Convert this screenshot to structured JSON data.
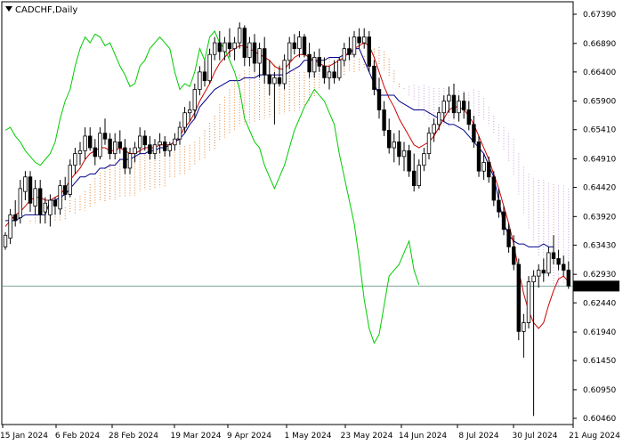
{
  "chart_data": {
    "type": "candlestick",
    "title": "CADCHF,Daily",
    "y_ticks": [
      "0.67390",
      "0.66890",
      "0.66400",
      "0.65900",
      "0.65410",
      "0.64910",
      "0.64420",
      "0.63920",
      "0.63430",
      "0.62930",
      "0.62440",
      "0.61940",
      "0.61450",
      "0.60950",
      "0.60460"
    ],
    "x_ticks": [
      "15 Jan 2024",
      "6 Feb 2024",
      "28 Feb 2024",
      "19 Mar 2024",
      "9 Apr 2024",
      "1 May 2024",
      "23 May 2024",
      "14 Jun 2024",
      "8 Jul 2024",
      "30 Jul 2024",
      "21 Aug 2024"
    ],
    "ylim": [
      0.6046,
      0.6739
    ],
    "current_price": "0.62728",
    "colors": {
      "tenkan": "#cc0000",
      "kijun": "#00008b",
      "chikou": "#00cc00",
      "senkou_a_cloud": "#e08030",
      "senkou_b_cloud": "#c8a0d8",
      "price_line": "#6a9a8a",
      "price_label_bg": "#000000"
    },
    "candles": [
      [
        0.634,
        0.6365,
        0.6335,
        0.636
      ],
      [
        0.6355,
        0.6405,
        0.6345,
        0.6395
      ],
      [
        0.6395,
        0.642,
        0.6375,
        0.6385
      ],
      [
        0.639,
        0.6455,
        0.638,
        0.644
      ],
      [
        0.6435,
        0.647,
        0.642,
        0.646
      ],
      [
        0.646,
        0.647,
        0.64,
        0.6415
      ],
      [
        0.641,
        0.6455,
        0.6395,
        0.644
      ],
      [
        0.644,
        0.6455,
        0.638,
        0.6395
      ],
      [
        0.64,
        0.6425,
        0.638,
        0.6415
      ],
      [
        0.6395,
        0.643,
        0.6375,
        0.642
      ],
      [
        0.642,
        0.6425,
        0.6395,
        0.641
      ],
      [
        0.6405,
        0.6455,
        0.6395,
        0.6445
      ],
      [
        0.6445,
        0.646,
        0.642,
        0.643
      ],
      [
        0.643,
        0.649,
        0.6425,
        0.648
      ],
      [
        0.648,
        0.651,
        0.6465,
        0.65
      ],
      [
        0.65,
        0.652,
        0.648,
        0.6505
      ],
      [
        0.6505,
        0.6545,
        0.649,
        0.653
      ],
      [
        0.653,
        0.6545,
        0.6505,
        0.651
      ],
      [
        0.651,
        0.6525,
        0.648,
        0.6495
      ],
      [
        0.6495,
        0.6545,
        0.649,
        0.6535
      ],
      [
        0.6535,
        0.656,
        0.6515,
        0.6525
      ],
      [
        0.6525,
        0.6535,
        0.649,
        0.65
      ],
      [
        0.65,
        0.6535,
        0.649,
        0.652
      ],
      [
        0.652,
        0.654,
        0.65,
        0.651
      ],
      [
        0.651,
        0.6525,
        0.6465,
        0.6475
      ],
      [
        0.6475,
        0.651,
        0.6465,
        0.65
      ],
      [
        0.65,
        0.652,
        0.6485,
        0.651
      ],
      [
        0.651,
        0.6545,
        0.65,
        0.653
      ],
      [
        0.653,
        0.654,
        0.6505,
        0.6515
      ],
      [
        0.6515,
        0.653,
        0.649,
        0.65
      ],
      [
        0.65,
        0.6525,
        0.649,
        0.6515
      ],
      [
        0.6515,
        0.6535,
        0.65,
        0.652
      ],
      [
        0.652,
        0.653,
        0.6495,
        0.6505
      ],
      [
        0.6505,
        0.652,
        0.6495,
        0.6515
      ],
      [
        0.6515,
        0.6535,
        0.6505,
        0.6525
      ],
      [
        0.6525,
        0.6555,
        0.6515,
        0.6545
      ],
      [
        0.6545,
        0.658,
        0.6535,
        0.657
      ],
      [
        0.657,
        0.659,
        0.6555,
        0.6575
      ],
      [
        0.6575,
        0.662,
        0.656,
        0.661
      ],
      [
        0.661,
        0.665,
        0.66,
        0.664
      ],
      [
        0.664,
        0.666,
        0.6615,
        0.6625
      ],
      [
        0.6625,
        0.668,
        0.662,
        0.667
      ],
      [
        0.667,
        0.67,
        0.666,
        0.669
      ],
      [
        0.669,
        0.671,
        0.666,
        0.6675
      ],
      [
        0.6675,
        0.67,
        0.666,
        0.669
      ],
      [
        0.669,
        0.6715,
        0.6665,
        0.668
      ],
      [
        0.668,
        0.67,
        0.666,
        0.669
      ],
      [
        0.669,
        0.6725,
        0.668,
        0.6715
      ],
      [
        0.6715,
        0.672,
        0.665,
        0.6665
      ],
      [
        0.6665,
        0.67,
        0.665,
        0.669
      ],
      [
        0.669,
        0.6705,
        0.664,
        0.6655
      ],
      [
        0.6655,
        0.669,
        0.663,
        0.668
      ],
      [
        0.668,
        0.67,
        0.662,
        0.6635
      ],
      [
        0.6635,
        0.666,
        0.66,
        0.662
      ],
      [
        0.662,
        0.664,
        0.655,
        0.663
      ],
      [
        0.663,
        0.665,
        0.6615,
        0.662
      ],
      [
        0.662,
        0.667,
        0.661,
        0.666
      ],
      [
        0.666,
        0.67,
        0.6645,
        0.669
      ],
      [
        0.669,
        0.6705,
        0.667,
        0.668
      ],
      [
        0.668,
        0.671,
        0.6665,
        0.67
      ],
      [
        0.67,
        0.6705,
        0.6665,
        0.667
      ],
      [
        0.667,
        0.669,
        0.663,
        0.664
      ],
      [
        0.664,
        0.6675,
        0.663,
        0.6665
      ],
      [
        0.6665,
        0.668,
        0.664,
        0.665
      ],
      [
        0.665,
        0.6665,
        0.662,
        0.663
      ],
      [
        0.663,
        0.665,
        0.661,
        0.664
      ],
      [
        0.664,
        0.666,
        0.662,
        0.663
      ],
      [
        0.663,
        0.6665,
        0.6625,
        0.666
      ],
      [
        0.666,
        0.669,
        0.665,
        0.668
      ],
      [
        0.668,
        0.67,
        0.666,
        0.667
      ],
      [
        0.667,
        0.671,
        0.6665,
        0.67
      ],
      [
        0.67,
        0.6715,
        0.668,
        0.669
      ],
      [
        0.669,
        0.6715,
        0.668,
        0.67
      ],
      [
        0.67,
        0.671,
        0.664,
        0.665
      ],
      [
        0.665,
        0.666,
        0.66,
        0.661
      ],
      [
        0.661,
        0.663,
        0.656,
        0.6575
      ],
      [
        0.6575,
        0.659,
        0.653,
        0.654
      ],
      [
        0.654,
        0.656,
        0.65,
        0.651
      ],
      [
        0.651,
        0.6535,
        0.6485,
        0.652
      ],
      [
        0.652,
        0.654,
        0.648,
        0.6495
      ],
      [
        0.6495,
        0.652,
        0.647,
        0.6505
      ],
      [
        0.6505,
        0.6515,
        0.646,
        0.647
      ],
      [
        0.647,
        0.65,
        0.6435,
        0.6445
      ],
      [
        0.6445,
        0.649,
        0.644,
        0.648
      ],
      [
        0.648,
        0.651,
        0.647,
        0.65
      ],
      [
        0.65,
        0.6545,
        0.649,
        0.6535
      ],
      [
        0.6535,
        0.656,
        0.652,
        0.655
      ],
      [
        0.655,
        0.658,
        0.654,
        0.657
      ],
      [
        0.657,
        0.66,
        0.6555,
        0.659
      ],
      [
        0.659,
        0.6615,
        0.657,
        0.66
      ],
      [
        0.66,
        0.662,
        0.656,
        0.657
      ],
      [
        0.657,
        0.66,
        0.6555,
        0.659
      ],
      [
        0.659,
        0.6605,
        0.656,
        0.6575
      ],
      [
        0.6575,
        0.659,
        0.654,
        0.655
      ],
      [
        0.655,
        0.6565,
        0.651,
        0.652
      ],
      [
        0.652,
        0.653,
        0.646,
        0.647
      ],
      [
        0.647,
        0.65,
        0.6455,
        0.6485
      ],
      [
        0.6485,
        0.6495,
        0.645,
        0.646
      ],
      [
        0.646,
        0.647,
        0.641,
        0.642
      ],
      [
        0.642,
        0.644,
        0.639,
        0.64
      ],
      [
        0.64,
        0.641,
        0.636,
        0.637
      ],
      [
        0.637,
        0.638,
        0.633,
        0.634
      ],
      [
        0.634,
        0.636,
        0.63,
        0.631
      ],
      [
        0.631,
        0.632,
        0.618,
        0.6195
      ],
      [
        0.6195,
        0.6225,
        0.615,
        0.621
      ],
      [
        0.621,
        0.629,
        0.62,
        0.628
      ],
      [
        0.628,
        0.63,
        0.605,
        0.629
      ],
      [
        0.629,
        0.631,
        0.627,
        0.63
      ],
      [
        0.63,
        0.632,
        0.628,
        0.6295
      ],
      [
        0.6295,
        0.634,
        0.629,
        0.633
      ],
      [
        0.633,
        0.636,
        0.631,
        0.632
      ],
      [
        0.632,
        0.6335,
        0.63,
        0.631
      ],
      [
        0.631,
        0.6325,
        0.629,
        0.63
      ],
      [
        0.63,
        0.6315,
        0.6268,
        0.6273
      ]
    ],
    "tenkan": [
      0.6375,
      0.6385,
      0.6395,
      0.64,
      0.641,
      0.642,
      0.6425,
      0.6425,
      0.642,
      0.642,
      0.6425,
      0.643,
      0.644,
      0.6455,
      0.6465,
      0.6475,
      0.649,
      0.65,
      0.6505,
      0.651,
      0.651,
      0.6505,
      0.6505,
      0.651,
      0.6505,
      0.65,
      0.65,
      0.6505,
      0.651,
      0.651,
      0.651,
      0.6515,
      0.6515,
      0.6515,
      0.652,
      0.653,
      0.6545,
      0.6555,
      0.657,
      0.659,
      0.6605,
      0.662,
      0.664,
      0.6655,
      0.6665,
      0.6675,
      0.668,
      0.6685,
      0.6685,
      0.668,
      0.6675,
      0.667,
      0.6665,
      0.666,
      0.665,
      0.6645,
      0.6645,
      0.6655,
      0.6665,
      0.667,
      0.667,
      0.6665,
      0.666,
      0.6655,
      0.665,
      0.665,
      0.6655,
      0.666,
      0.6665,
      0.6675,
      0.668,
      0.6685,
      0.669,
      0.6685,
      0.6665,
      0.664,
      0.6615,
      0.6595,
      0.658,
      0.656,
      0.6545,
      0.653,
      0.6515,
      0.651,
      0.6515,
      0.652,
      0.653,
      0.6545,
      0.656,
      0.6575,
      0.658,
      0.658,
      0.6575,
      0.6565,
      0.655,
      0.653,
      0.651,
      0.649,
      0.6465,
      0.644,
      0.641,
      0.638,
      0.6345,
      0.63,
      0.626,
      0.623,
      0.621,
      0.62,
      0.621,
      0.624,
      0.6265,
      0.6285,
      0.629,
      0.628
    ],
    "kijun": [
      0.6385,
      0.6385,
      0.6385,
      0.639,
      0.6395,
      0.6395,
      0.6395,
      0.6395,
      0.6395,
      0.642,
      0.642,
      0.6425,
      0.643,
      0.644,
      0.645,
      0.646,
      0.646,
      0.6465,
      0.6465,
      0.6475,
      0.6475,
      0.648,
      0.648,
      0.649,
      0.649,
      0.649,
      0.6495,
      0.65,
      0.65,
      0.6505,
      0.6505,
      0.651,
      0.651,
      0.6515,
      0.652,
      0.6525,
      0.6535,
      0.655,
      0.656,
      0.658,
      0.659,
      0.66,
      0.661,
      0.6615,
      0.662,
      0.6625,
      0.6625,
      0.6625,
      0.663,
      0.663,
      0.663,
      0.6635,
      0.6635,
      0.6635,
      0.6635,
      0.6635,
      0.6635,
      0.664,
      0.6645,
      0.665,
      0.666,
      0.666,
      0.666,
      0.666,
      0.666,
      0.6665,
      0.6665,
      0.6665,
      0.667,
      0.667,
      0.668,
      0.668,
      0.666,
      0.664,
      0.662,
      0.66,
      0.66,
      0.66,
      0.66,
      0.659,
      0.6585,
      0.658,
      0.6575,
      0.6575,
      0.6575,
      0.657,
      0.6565,
      0.656,
      0.6555,
      0.655,
      0.655,
      0.6545,
      0.654,
      0.653,
      0.652,
      0.651,
      0.65,
      0.648,
      0.646,
      0.642,
      0.638,
      0.636,
      0.635,
      0.6345,
      0.6345,
      0.634,
      0.634,
      0.634,
      0.6345,
      0.634,
      0.634
    ],
    "chikou": [
      0.654,
      0.6545,
      0.653,
      0.652,
      0.6505,
      0.6495,
      0.6485,
      0.648,
      0.649,
      0.65,
      0.652,
      0.656,
      0.659,
      0.661,
      0.665,
      0.668,
      0.67,
      0.669,
      0.6705,
      0.67,
      0.6685,
      0.669,
      0.667,
      0.665,
      0.6635,
      0.6615,
      0.662,
      0.665,
      0.666,
      0.668,
      0.669,
      0.67,
      0.669,
      0.668,
      0.664,
      0.661,
      0.662,
      0.6615,
      0.664,
      0.668,
      0.666,
      0.67,
      0.671,
      0.669,
      0.668,
      0.666,
      0.664,
      0.661,
      0.656,
      0.654,
      0.652,
      0.651,
      0.648,
      0.646,
      0.644,
      0.646,
      0.648,
      0.651,
      0.654,
      0.656,
      0.658,
      0.6595,
      0.661,
      0.66,
      0.659,
      0.657,
      0.655,
      0.65,
      0.646,
      0.642,
      0.638,
      0.632,
      0.625,
      0.62,
      0.6175,
      0.619,
      0.624,
      0.629,
      0.63,
      0.631,
      0.633,
      0.635,
      0.63,
      0.6275
    ]
  }
}
